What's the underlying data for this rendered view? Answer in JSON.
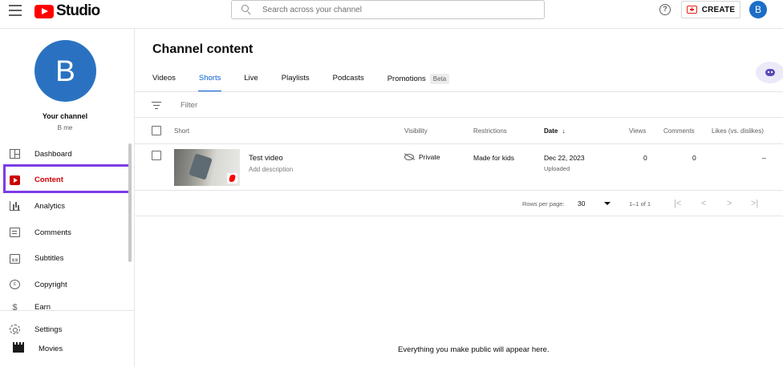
{
  "app": {
    "logo_text": "Studio"
  },
  "search": {
    "placeholder": "Search across your channel"
  },
  "header": {
    "help_icon_glyph": "?",
    "create_label": "CREATE",
    "avatar_letter": "B"
  },
  "sidebar": {
    "channel_avatar_letter": "B",
    "channel_title": "Your channel",
    "channel_handle": "B me",
    "items": [
      {
        "label": "Dashboard",
        "icon": "dashboard-icon"
      },
      {
        "label": "Content",
        "icon": "content-icon",
        "active": true
      },
      {
        "label": "Analytics",
        "icon": "analytics-icon"
      },
      {
        "label": "Comments",
        "icon": "comments-icon"
      },
      {
        "label": "Subtitles",
        "icon": "subtitles-icon"
      },
      {
        "label": "Copyright",
        "icon": "copyright-icon"
      },
      {
        "label": "Earn",
        "icon": "earn-icon"
      }
    ],
    "settings_label": "Settings",
    "movies_label": "Movies",
    "highlight_color": "#7b3ce6"
  },
  "main": {
    "title": "Channel content",
    "tabs": [
      {
        "label": "Videos"
      },
      {
        "label": "Shorts",
        "active": true
      },
      {
        "label": "Live"
      },
      {
        "label": "Playlists"
      },
      {
        "label": "Podcasts"
      },
      {
        "label": "Promotions",
        "badge": "Beta"
      }
    ],
    "filter_label": "Filter",
    "columns": {
      "short": "Short",
      "visibility": "Visibility",
      "restrictions": "Restrictions",
      "date": "Date",
      "date_sort_icon": "↓",
      "views": "Views",
      "comments": "Comments",
      "likes": "Likes (vs. dislikes)"
    },
    "rows": [
      {
        "title": "Test video",
        "description": "Add description",
        "visibility": "Private",
        "restrictions": "Made for kids",
        "date": "Dec 22, 2023",
        "date_status": "Uploaded",
        "views": "0",
        "comments": "0",
        "likes": "–"
      }
    ],
    "pagination": {
      "rows_per_page_label": "Rows per page:",
      "rows_per_page": "30",
      "range": "1–1 of 1",
      "first_glyph": "|<",
      "prev_glyph": "<",
      "next_glyph": ">",
      "last_glyph": ">|"
    },
    "empty_message": "Everything you make public will appear here."
  },
  "colors": {
    "accent": "#065fd4",
    "brand_red": "#ff0000",
    "active_nav": "#cc0000"
  }
}
